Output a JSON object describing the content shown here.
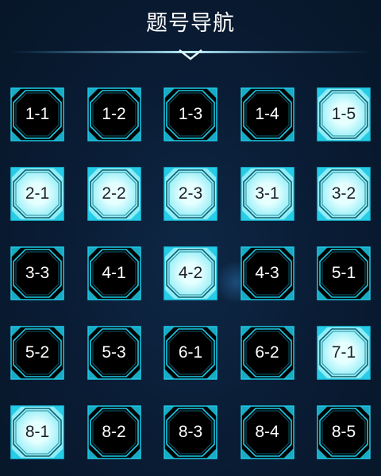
{
  "header": {
    "title": "题号导航"
  },
  "colors": {
    "accent": "#1ec9e6",
    "tile_done_fill": "#e6ffff",
    "tile_pending_fill": "#000000"
  },
  "questions": [
    {
      "label": "1-1",
      "done": false
    },
    {
      "label": "1-2",
      "done": false
    },
    {
      "label": "1-3",
      "done": false
    },
    {
      "label": "1-4",
      "done": false
    },
    {
      "label": "1-5",
      "done": true
    },
    {
      "label": "2-1",
      "done": true
    },
    {
      "label": "2-2",
      "done": true
    },
    {
      "label": "2-3",
      "done": true
    },
    {
      "label": "3-1",
      "done": true
    },
    {
      "label": "3-2",
      "done": true
    },
    {
      "label": "3-3",
      "done": false
    },
    {
      "label": "4-1",
      "done": false
    },
    {
      "label": "4-2",
      "done": true
    },
    {
      "label": "4-3",
      "done": false
    },
    {
      "label": "5-1",
      "done": false
    },
    {
      "label": "5-2",
      "done": false
    },
    {
      "label": "5-3",
      "done": false
    },
    {
      "label": "6-1",
      "done": false
    },
    {
      "label": "6-2",
      "done": false
    },
    {
      "label": "7-1",
      "done": true
    },
    {
      "label": "8-1",
      "done": true
    },
    {
      "label": "8-2",
      "done": false
    },
    {
      "label": "8-3",
      "done": false
    },
    {
      "label": "8-4",
      "done": false
    },
    {
      "label": "8-5",
      "done": false
    }
  ]
}
